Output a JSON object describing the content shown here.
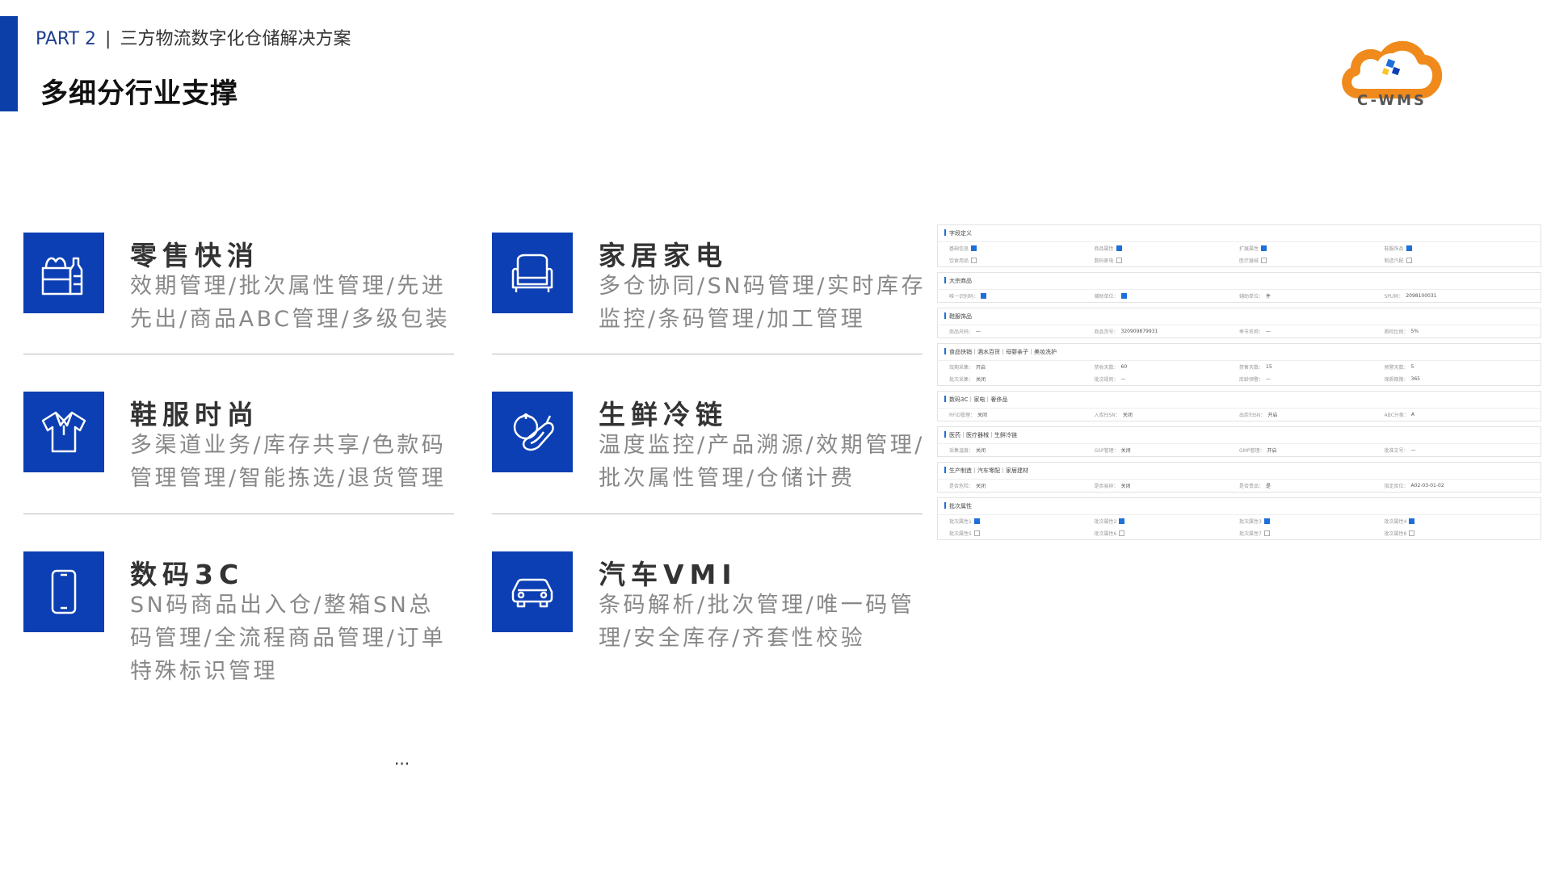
{
  "header": {
    "part": "PART 2",
    "separator": "|",
    "subtitle": "三方物流数字化仓储解决方案",
    "title": "多细分行业支撑"
  },
  "logo": {
    "text": "C-WMS",
    "colors": {
      "orange": "#f08a1d",
      "blue": "#1e6fd9"
    }
  },
  "industries": [
    {
      "title": "零售快消",
      "desc": "效期管理/批次属性管理/先进先出/商品ABC管理/多级包装",
      "icon": "grocery-bag-icon"
    },
    {
      "title": "家居家电",
      "desc": "多仓协同/SN码管理/实时库存监控/条码管理/加工管理",
      "icon": "sofa-icon"
    },
    {
      "title": "鞋服时尚",
      "desc": "多渠道业务/库存共享/色款码管理管理/智能拣选/退货管理",
      "icon": "shirt-icon"
    },
    {
      "title": "生鲜冷链",
      "desc": "温度监控/产品溯源/效期管理/批次属性管理/仓储计费",
      "icon": "vegetables-icon"
    },
    {
      "title": "数码3C",
      "desc": "SN码商品出入仓/整箱SN总码管理/全流程商品管理/订单特殊标识管理",
      "icon": "smartphone-icon"
    },
    {
      "title": "汽车VMI",
      "desc": "条码解析/批次管理/唯一码管理/安全库存/齐套性校验",
      "icon": "car-icon"
    }
  ],
  "ellipsis": "...",
  "accent_color": "#0c3fb3",
  "form_sections": [
    {
      "title": "字段定义",
      "rows": [
        [
          {
            "label": "基础信息",
            "check": true
          },
          {
            "label": "商品属性",
            "check": true
          },
          {
            "label": "扩展属性",
            "check": true
          },
          {
            "label": "鞋服饰品",
            "check": true
          }
        ],
        [
          {
            "label": "饮食用品",
            "check": false
          },
          {
            "label": "数码家电",
            "check": false
          },
          {
            "label": "医疗器械",
            "check": false
          },
          {
            "label": "制造汽配",
            "check": false
          }
        ]
      ]
    },
    {
      "title": "大宗商品",
      "rows": [
        [
          {
            "label": "唯一识别码：",
            "check": true
          },
          {
            "label": "辅助单位：",
            "check": true
          },
          {
            "label": "辅助单位：",
            "value": "件"
          },
          {
            "label": "SPU码：",
            "value": "2098100031"
          }
        ]
      ]
    },
    {
      "title": "鞋服饰品",
      "rows": [
        [
          {
            "label": "商品尺码：",
            "value": "—"
          },
          {
            "label": "商品货号：",
            "value": "320909879931"
          },
          {
            "label": "季节名称：",
            "value": "—"
          },
          {
            "label": "质检比例：",
            "value": "5%"
          }
        ]
      ]
    },
    {
      "title": "食品快销｜酒水百货｜母婴亲子｜美妆洗护",
      "rows": [
        [
          {
            "label": "效期采集：",
            "value": "开启"
          },
          {
            "label": "禁收天数：",
            "value": "60"
          },
          {
            "label": "禁售天数：",
            "value": "15"
          },
          {
            "label": "预警天数：",
            "value": "5"
          }
        ],
        [
          {
            "label": "批次采集：",
            "value": "关闭"
          },
          {
            "label": "批次规则：",
            "value": "—"
          },
          {
            "label": "库龄预警：",
            "value": "—"
          },
          {
            "label": "保质期限：",
            "value": "365"
          }
        ]
      ]
    },
    {
      "title": "数码3C｜家电｜奢侈品",
      "rows": [
        [
          {
            "label": "RFID管理：",
            "value": "关闭"
          },
          {
            "label": "入库扫SN：",
            "value": "关闭"
          },
          {
            "label": "出库扫SN：",
            "value": "开启"
          },
          {
            "label": "ABC分类：",
            "value": "A"
          }
        ]
      ]
    },
    {
      "title": "医药｜医疗器械｜生鲜冷链",
      "rows": [
        [
          {
            "label": "采集温度：",
            "value": "关闭"
          },
          {
            "label": "GSP管理：",
            "value": "关闭"
          },
          {
            "label": "GMP管理：",
            "value": "开启"
          },
          {
            "label": "批准文号：",
            "value": "—"
          }
        ]
      ]
    },
    {
      "title": "生产制造｜汽车零配｜家居建材",
      "rows": [
        [
          {
            "label": "是否危险：",
            "value": "关闭"
          },
          {
            "label": "是否易碎：",
            "value": "关闭"
          },
          {
            "label": "是否贵品：",
            "value": "是"
          },
          {
            "label": "指定库位：",
            "value": "A02-03-01-02"
          }
        ]
      ]
    },
    {
      "title": "批次属性",
      "rows": [
        [
          {
            "label": "批次属性1",
            "check": true
          },
          {
            "label": "批次属性2",
            "check": true
          },
          {
            "label": "批次属性3",
            "check": true
          },
          {
            "label": "批次属性4",
            "check": true
          }
        ],
        [
          {
            "label": "批次属性5",
            "check": false
          },
          {
            "label": "批次属性6",
            "check": false
          },
          {
            "label": "批次属性7",
            "check": false
          },
          {
            "label": "批次属性8",
            "check": false
          }
        ]
      ]
    }
  ]
}
